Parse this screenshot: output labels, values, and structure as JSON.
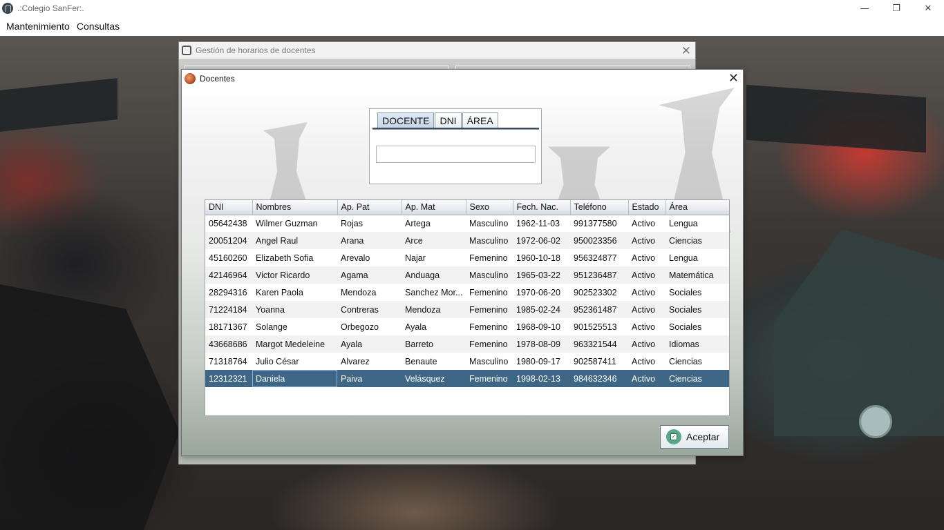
{
  "app": {
    "title": ".:Colegio SanFer:."
  },
  "window_controls": {
    "minimize": "—",
    "restore": "❐",
    "close": "✕"
  },
  "menu": [
    "Mantenimiento",
    "Consultas"
  ],
  "back_frame": {
    "title": "Gestión de horarios de docentes",
    "close": "✕"
  },
  "dialog": {
    "title": "Docentes",
    "close": "✕",
    "tabs": [
      {
        "label": "DOCENTE",
        "active": true
      },
      {
        "label": "DNI",
        "active": false
      },
      {
        "label": "ÁREA",
        "active": false
      }
    ],
    "search": {
      "value": "",
      "placeholder": ""
    },
    "table": {
      "columns": [
        "DNI",
        "Nombres",
        "Ap. Pat",
        "Ap. Mat",
        "Sexo",
        "Fech. Nac.",
        "Teléfono",
        "Estado",
        "Área"
      ],
      "rows": [
        [
          "05642438",
          "Wilmer Guzman",
          "Rojas",
          "Artega",
          "Masculino",
          "1962-11-03",
          "991377580",
          "Activo",
          "Lengua"
        ],
        [
          "20051204",
          "Angel Raul",
          "Arana",
          "Arce",
          "Masculino",
          "1972-06-02",
          "950023356",
          "Activo",
          "Ciencias"
        ],
        [
          "45160260",
          "Elizabeth Sofia",
          "Arevalo",
          "Najar",
          "Femenino",
          "1960-10-18",
          "956324877",
          "Activo",
          "Lengua"
        ],
        [
          "42146964",
          "Victor Ricardo",
          "Agama",
          "Anduaga",
          "Masculino",
          "1965-03-22",
          "951236487",
          "Activo",
          "Matemática"
        ],
        [
          "28294316",
          "Karen Paola",
          "Mendoza",
          "Sanchez Mor...",
          "Femenino",
          "1970-06-20",
          "902523302",
          "Activo",
          "Sociales"
        ],
        [
          "71224184",
          "Yoanna",
          "Contreras",
          "Mendoza",
          "Femenino",
          "1985-02-24",
          "952361487",
          "Activo",
          "Sociales"
        ],
        [
          "18171367",
          "Solange",
          "Orbegozo",
          "Ayala",
          "Femenino",
          "1968-09-10",
          "901525513",
          "Activo",
          "Sociales"
        ],
        [
          "43668686",
          "Margot Medeleine",
          "Ayala",
          "Barreto",
          "Femenino",
          "1978-08-09",
          "963321544",
          "Activo",
          "Idiomas"
        ],
        [
          "71318764",
          "Julio César",
          "Alvarez",
          "Benaute",
          "Masculino",
          "1980-09-17",
          "902587411",
          "Activo",
          "Ciencias"
        ],
        [
          "12312321",
          "Daniela",
          "Paiva",
          "Velásquez",
          "Femenino",
          "1998-02-13",
          "984632346",
          "Activo",
          "Ciencias"
        ]
      ],
      "selected_row": 9
    },
    "accept_button": {
      "label": "Aceptar",
      "icon": "checkbox-icon"
    }
  },
  "colors": {
    "selection": "#3e6685",
    "accent_icon": "#5aa88a"
  }
}
